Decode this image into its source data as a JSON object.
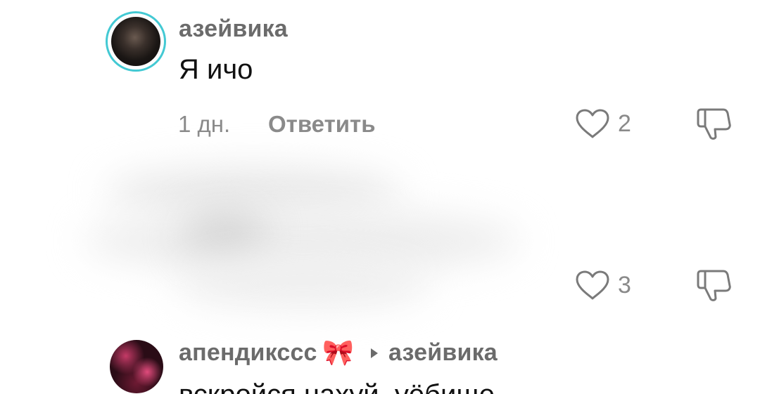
{
  "comments": [
    {
      "username": "азейвика",
      "text": "Я ичо",
      "time": "1 дн.",
      "reply_label": "Ответить",
      "likes": "2",
      "avatar_ring_color": "#43c9d3"
    },
    {
      "hidden": true,
      "likes": "3"
    },
    {
      "username": "апендикссс",
      "username_emoji": "🎀",
      "reply_to": "азейвика",
      "text": "вскройся нахуй, уёбище"
    }
  ],
  "icons": {
    "like": "heart-outline-icon",
    "dislike": "thumbs-down-outline-icon",
    "reply_arrow": "triangle-right-icon"
  }
}
